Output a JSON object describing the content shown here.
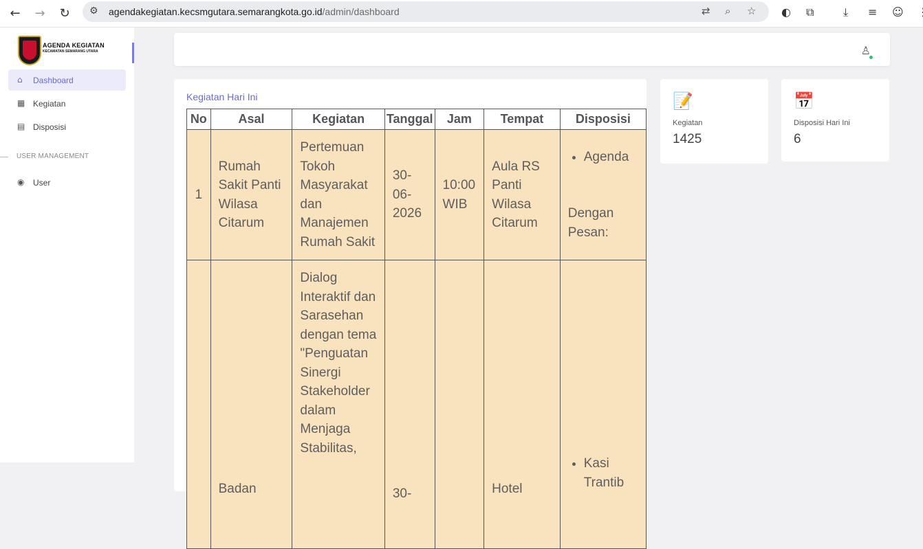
{
  "browser": {
    "url_host": "agendakegiatan.kecsmgutara.semarangkota.go.id",
    "url_path": "/admin/dashboard"
  },
  "sidebar": {
    "logo_title": "AGENDA KEGIATAN",
    "logo_subtitle": "KECAMATAN SEMARANG UTARA",
    "items": [
      {
        "label": "Dashboard",
        "icon": "home-icon"
      },
      {
        "label": "Kegiatan",
        "icon": "calendar-icon"
      },
      {
        "label": "Disposisi",
        "icon": "file-icon"
      }
    ],
    "section_label": "USER MANAGEMENT",
    "user_item": {
      "label": "User",
      "icon": "user-circle-icon"
    }
  },
  "today": {
    "title": "Kegiatan Hari Ini",
    "headers": [
      "No",
      "Asal",
      "Kegiatan",
      "Tanggal",
      "Jam",
      "Tempat",
      "Disposisi"
    ],
    "rows": [
      {
        "no": "1",
        "asal": "Rumah Sakit Panti Wilasa Citarum",
        "kegiatan": "Pertemuan Tokoh Masyarakat dan Manajemen Rumah Sakit",
        "tanggal": "30-06-2026",
        "jam": "10:00 WIB",
        "tempat": "Aula RS Panti Wilasa Citarum",
        "disposisi_item": "Agenda",
        "disposisi_note": "Dengan Pesan:"
      },
      {
        "no": "",
        "asal": "Badan",
        "kegiatan": "Dialog Interaktif dan Sarasehan dengan tema \"Penguatan Sinergi Stakeholder dalam Menjaga Stabilitas,",
        "tanggal": "30-",
        "jam": "",
        "tempat": "Hotel",
        "disposisi_item": "Kasi Trantib",
        "disposisi_note": ""
      }
    ]
  },
  "stats": [
    {
      "label": "Kegiatan",
      "value": "1425",
      "icon": "notepad-icon"
    },
    {
      "label": "Disposisi Hari Ini",
      "value": "6",
      "icon": "calendar-group-icon"
    }
  ]
}
